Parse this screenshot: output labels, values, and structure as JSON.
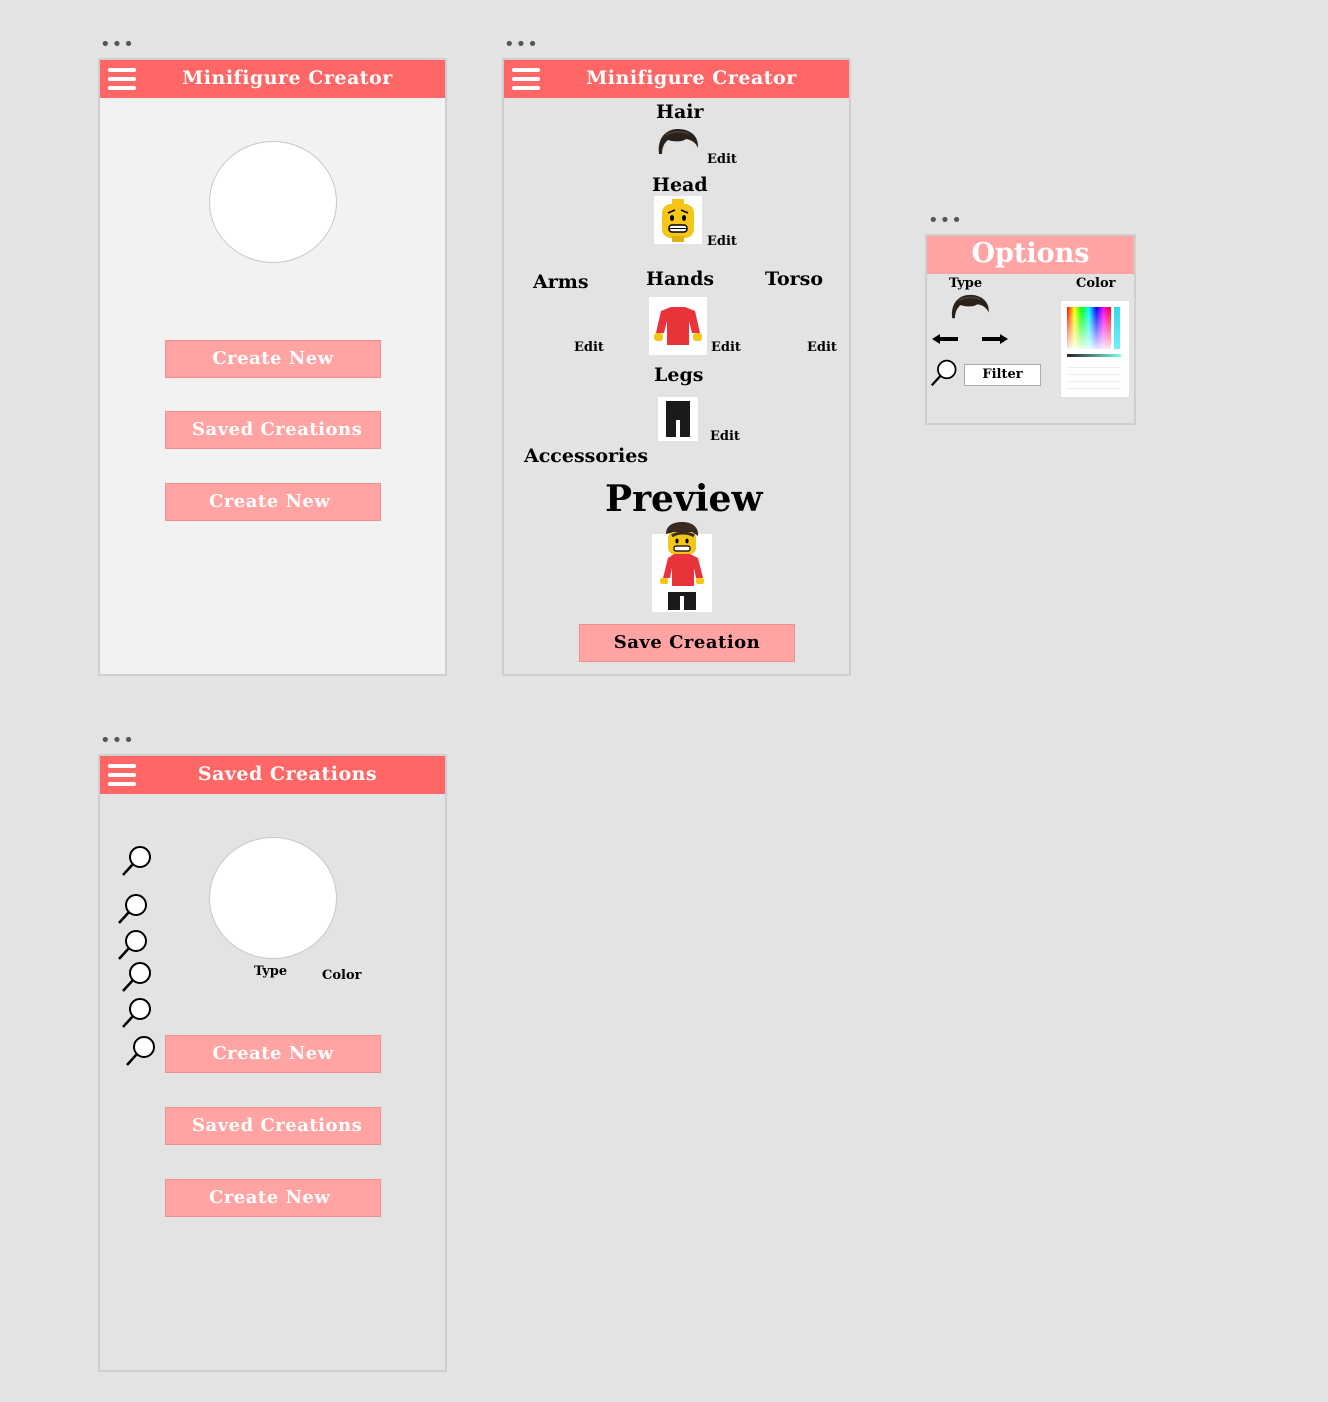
{
  "screen1": {
    "title": "Minifigure Creator",
    "buttons": [
      "Create New",
      "Saved Creations",
      "Create New"
    ]
  },
  "screen2": {
    "title": "Minifigure Creator",
    "sections": {
      "hair": "Hair",
      "head": "Head",
      "arms": "Arms",
      "hands": "Hands",
      "torso": "Torso",
      "legs": "Legs",
      "accessories": "Accessories"
    },
    "edit_label": "Edit",
    "preview_label": "Preview",
    "save_label": "Save Creation",
    "colors": {
      "header": "#ff6666",
      "button": "#ffa3a3",
      "torso": "#e8333b"
    }
  },
  "options": {
    "title": "Options",
    "type_label": "Type",
    "color_label": "Color",
    "filter_label": "Filter"
  },
  "screen3": {
    "title": "Saved Creations",
    "type_label": "Type",
    "color_label": "Color",
    "buttons": [
      "Create New",
      "Saved Creations",
      "Create New"
    ]
  }
}
